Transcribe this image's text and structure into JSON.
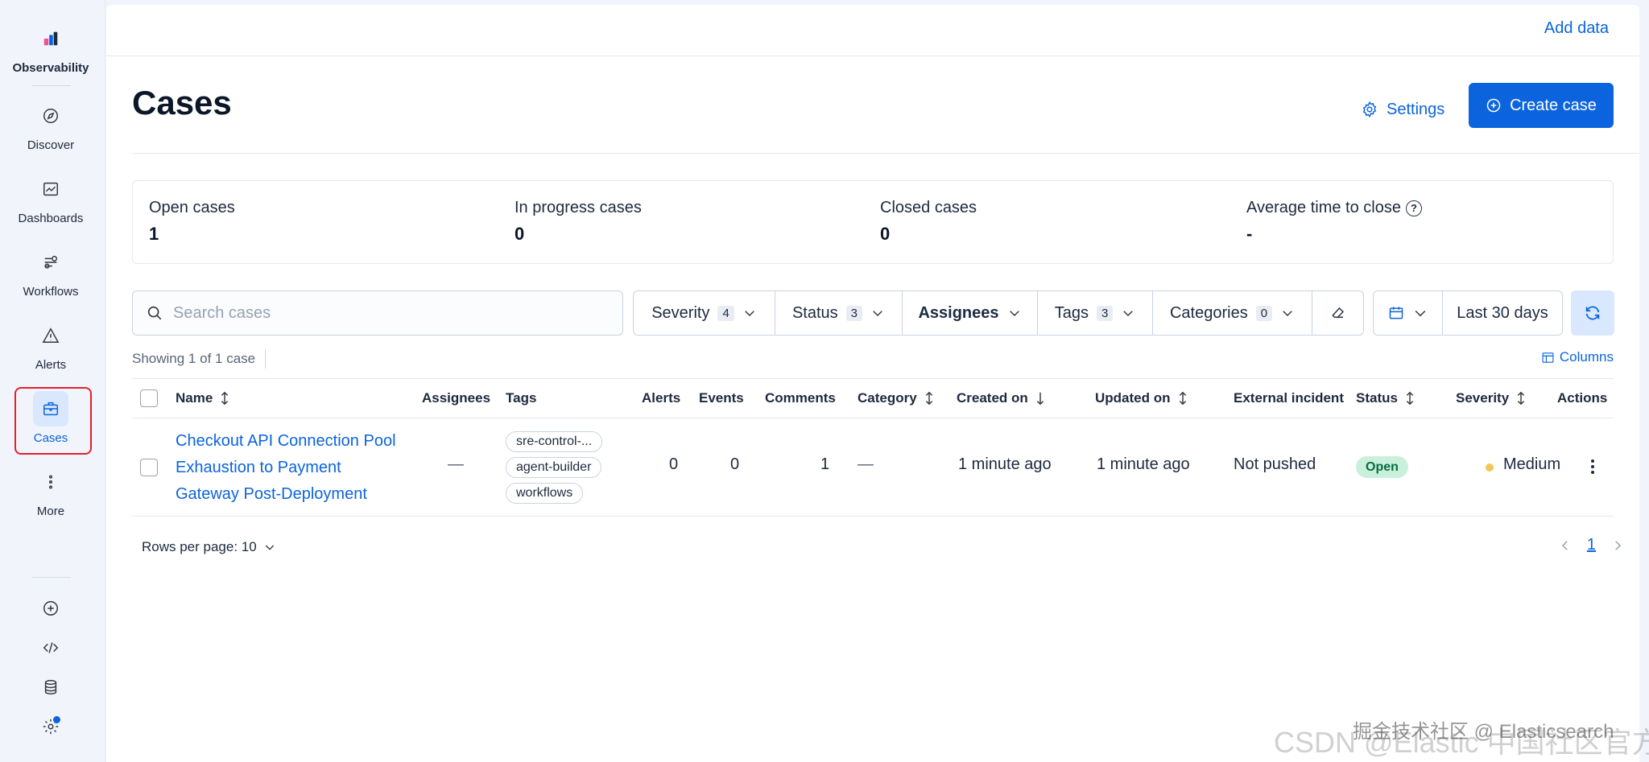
{
  "sidebar": {
    "logo_label": "Observability",
    "items": [
      {
        "label": "Discover",
        "icon": "compass-icon"
      },
      {
        "label": "Dashboards",
        "icon": "dashboard-icon"
      },
      {
        "label": "Workflows",
        "icon": "workflow-icon"
      },
      {
        "label": "Alerts",
        "icon": "alert-icon"
      },
      {
        "label": "Cases",
        "icon": "briefcase-icon"
      },
      {
        "label": "More",
        "icon": "more-vertical-icon"
      }
    ],
    "bottom_icons": [
      "add-circle-icon",
      "code-icon",
      "database-icon",
      "gear-icon"
    ]
  },
  "header": {
    "add_data": "Add data"
  },
  "page": {
    "title": "Cases",
    "settings_label": "Settings",
    "create_label": "Create case"
  },
  "stats": [
    {
      "label": "Open cases",
      "value": "1"
    },
    {
      "label": "In progress cases",
      "value": "0"
    },
    {
      "label": "Closed cases",
      "value": "0"
    },
    {
      "label": "Average time to close",
      "value": "-"
    }
  ],
  "filters": {
    "search_placeholder": "Search cases",
    "severity": {
      "label": "Severity",
      "count": "4"
    },
    "status": {
      "label": "Status",
      "count": "3"
    },
    "assignees": {
      "label": "Assignees"
    },
    "tags": {
      "label": "Tags",
      "count": "3"
    },
    "categories": {
      "label": "Categories",
      "count": "0"
    },
    "date_range": "Last 30 days"
  },
  "table": {
    "showing": "Showing 1 of 1 case",
    "columns_label": "Columns",
    "headers": {
      "name": "Name",
      "assignees": "Assignees",
      "tags": "Tags",
      "alerts": "Alerts",
      "events": "Events",
      "comments": "Comments",
      "category": "Category",
      "created_on": "Created on",
      "updated_on": "Updated on",
      "external_incident": "External incident",
      "status": "Status",
      "severity": "Severity",
      "actions": "Actions"
    },
    "rows": [
      {
        "name_lines": [
          "Checkout API Connection Pool",
          "Exhaustion to Payment",
          "Gateway Post-Deployment"
        ],
        "assignees": "—",
        "tags": [
          "sre-control-...",
          "agent-builder",
          "workflows"
        ],
        "alerts": "0",
        "events": "0",
        "comments": "1",
        "category": "—",
        "created_on": "1 minute ago",
        "updated_on": "1 minute ago",
        "external_incident": "Not pushed",
        "status": "Open",
        "severity": "Medium"
      }
    ]
  },
  "pagination": {
    "rows_per_page": "Rows per page: 10",
    "current_page": "1"
  },
  "watermark": "CSDN @Elastic 中国社区官方博客",
  "watermark_overlay": "掘金技术社区 @ Elasticsearch",
  "colors": {
    "accent": "#0b64dd",
    "status_open_bg": "#c8f0db",
    "severity_medium": "#f3c657",
    "highlight_frame": "#e0212f"
  }
}
